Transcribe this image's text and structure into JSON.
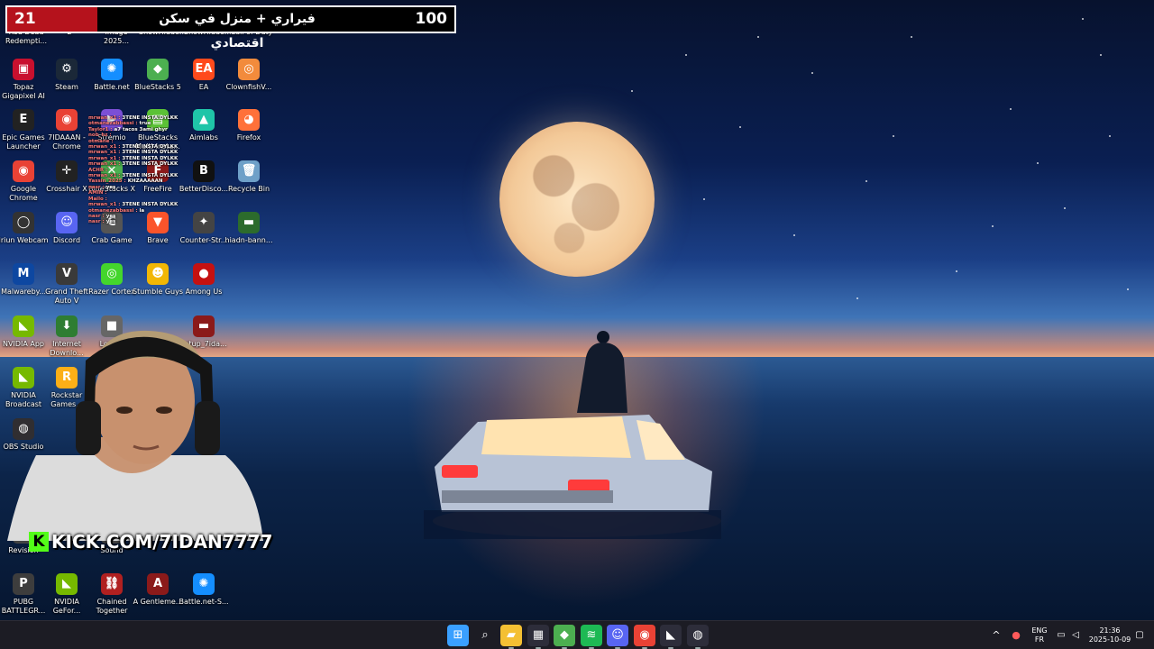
{
  "banner": {
    "left_count": "21",
    "goal_text": "فيراري + منزل في سكن اقتصادي",
    "right_count": "100"
  },
  "partial_top_labels": [
    "Red Dead Redempti...",
    "2",
    "Image 2025...",
    "ShowHidde...",
    "ShowHidde...",
    "Call of Duty"
  ],
  "desktop_icons": [
    {
      "label": "Topaz Gigapixel AI",
      "icon": "topaz-icon",
      "color": "#c8102e",
      "glyph": "▣"
    },
    {
      "label": "Steam",
      "icon": "steam-icon",
      "color": "#1b2838",
      "glyph": "⚙"
    },
    {
      "label": "Battle.net",
      "icon": "battlenet-icon",
      "color": "#148eff",
      "glyph": "✺"
    },
    {
      "label": "BlueStacks 5",
      "icon": "bluestacks-icon",
      "color": "#4caf50",
      "glyph": "◆"
    },
    {
      "label": "EA",
      "icon": "ea-icon",
      "color": "#ff4a1c",
      "glyph": "EA"
    },
    {
      "label": "ClownfishV...",
      "icon": "clownfish-icon",
      "color": "#f28b3c",
      "glyph": "◎"
    },
    {
      "label": "Epic Games Launcher",
      "icon": "epic-games-icon",
      "color": "#222222",
      "glyph": "E"
    },
    {
      "label": "7IDAAAN - Chrome",
      "icon": "chrome-icon",
      "color": "#e94235",
      "glyph": "◉"
    },
    {
      "label": "Stremio",
      "icon": "stremio-icon",
      "color": "#7b4fd6",
      "glyph": "▶"
    },
    {
      "label": "BlueStacks Multi-Insta...",
      "icon": "bluestacks-multi-icon",
      "color": "#5bc236",
      "glyph": "▤"
    },
    {
      "label": "Aimlabs",
      "icon": "aimlabs-icon",
      "color": "#1fc5a8",
      "glyph": "▲"
    },
    {
      "label": "Firefox",
      "icon": "firefox-icon",
      "color": "#ff7139",
      "glyph": "◕"
    },
    {
      "label": "Google Chrome",
      "icon": "chrome-icon",
      "color": "#e94235",
      "glyph": "◉"
    },
    {
      "label": "Crosshair X",
      "icon": "crosshair-icon",
      "color": "#222222",
      "glyph": "✛"
    },
    {
      "label": "BlueStacks X",
      "icon": "bluestacks-x-icon",
      "color": "#4caf50",
      "glyph": "✕"
    },
    {
      "label": "FreeFire",
      "icon": "freefire-icon",
      "color": "#8b1a1a",
      "glyph": "F"
    },
    {
      "label": "BetterDisco...",
      "icon": "betterdiscord-icon",
      "color": "#111111",
      "glyph": "B"
    },
    {
      "label": "Recycle Bin",
      "icon": "recycle-bin-icon",
      "color": "#6ea0c8",
      "glyph": "🗑"
    },
    {
      "label": "Iriun Webcam",
      "icon": "iriun-icon",
      "color": "#333333",
      "glyph": "◯"
    },
    {
      "label": "Discord",
      "icon": "discord-icon",
      "color": "#5865f2",
      "glyph": "☺"
    },
    {
      "label": "Crab Game",
      "icon": "crab-game-icon",
      "color": "#555555",
      "glyph": "C"
    },
    {
      "label": "Brave",
      "icon": "brave-icon",
      "color": "#fb542b",
      "glyph": "▼"
    },
    {
      "label": "Counter-Str...",
      "icon": "counter-strike-icon",
      "color": "#444444",
      "glyph": "✦"
    },
    {
      "label": "hiadn-bann...",
      "icon": "file-icon",
      "color": "#2c6b2c",
      "glyph": "▬"
    },
    {
      "label": "Malwareby...",
      "icon": "malwarebytes-icon",
      "color": "#0d47a1",
      "glyph": "M"
    },
    {
      "label": "Grand Theft Auto V",
      "icon": "gta-icon",
      "color": "#3a3a3a",
      "glyph": "V"
    },
    {
      "label": "Razer Cortex",
      "icon": "razer-icon",
      "color": "#44d62c",
      "glyph": "◎"
    },
    {
      "label": "Stumble Guys",
      "icon": "stumble-guys-icon",
      "color": "#f2b705",
      "glyph": "☻"
    },
    {
      "label": "Among Us",
      "icon": "among-us-icon",
      "color": "#c51111",
      "glyph": "●"
    },
    {
      "label": "NVIDIA App",
      "icon": "nvidia-icon",
      "color": "#76b900",
      "glyph": "◣"
    },
    {
      "label": "Internet Downlo...",
      "icon": "idm-icon",
      "color": "#2e7d32",
      "glyph": "⬇"
    },
    {
      "label": "Lone...",
      "icon": "app-icon",
      "color": "#666666",
      "glyph": "■"
    },
    {
      "label": "setup_7ida...",
      "icon": "setup-icon",
      "color": "#8b1a1a",
      "glyph": "▬"
    },
    {
      "label": "NVIDIA Broadcast",
      "icon": "nvidia-broadcast-icon",
      "color": "#76b900",
      "glyph": "◣"
    },
    {
      "label": "Rockstar Games...",
      "icon": "rockstar-icon",
      "color": "#fcaf17",
      "glyph": "R"
    },
    {
      "label": "OBS Studio",
      "icon": "obs-icon",
      "color": "#302e31",
      "glyph": "◍"
    },
    {
      "label": "Revision",
      "icon": "revision-icon",
      "color": "#444444",
      "glyph": "R"
    },
    {
      "label": "Sound",
      "icon": "sound-icon",
      "color": "#444444",
      "glyph": "♪"
    },
    {
      "label": "PUBG BATTLEGR...",
      "icon": "pubg-icon",
      "color": "#3d3d3d",
      "glyph": "P"
    },
    {
      "label": "NVIDIA GeFor...",
      "icon": "geforce-icon",
      "color": "#76b900",
      "glyph": "◣"
    },
    {
      "label": "Chained Together",
      "icon": "chained-together-icon",
      "color": "#b02020",
      "glyph": "⛓"
    },
    {
      "label": "A Gentleme...",
      "icon": "gentleman-icon",
      "color": "#8b1a1a",
      "glyph": "A"
    },
    {
      "label": "Battle.net-S...",
      "icon": "battlenet-icon",
      "color": "#148eff",
      "glyph": "✺"
    }
  ],
  "chat": [
    {
      "user": "mrwan_x1 :",
      "msg": "3TENE INSTA DYLKK"
    },
    {
      "user": "otmanezabbassi :",
      "msg": "true"
    },
    {
      "user": "Taylor1 :",
      "msg": "a7 tacos 3ami ghyr"
    },
    {
      "user": "nob_hz :",
      "msg": ""
    },
    {
      "user": "otmane :",
      "msg": ""
    },
    {
      "user": "mrwan_x1 :",
      "msg": "3TENE INSTA DYLKK"
    },
    {
      "user": "mrwan_x1 :",
      "msg": "3TENE INSTA DYLKK"
    },
    {
      "user": "mrwan_x1 :",
      "msg": "3TENE INSTA DYLKK"
    },
    {
      "user": "mrwan_x1 :",
      "msg": "3TENE INSTA DYLKK"
    },
    {
      "user": "ACHR :",
      "msg": ""
    },
    {
      "user": "mrwan_x1 :",
      "msg": "3TENE INSTA DYLKK"
    },
    {
      "user": "Yassin_2025 :",
      "msg": "KHZAAAAAN"
    },
    {
      "user": "nasr :",
      "msg": "yes"
    },
    {
      "user": "AMIN :",
      "msg": ""
    },
    {
      "user": "Mailo :",
      "msg": ""
    },
    {
      "user": "mrwan_x1 :",
      "msg": "3TENE INSTA DYLKK"
    },
    {
      "user": "otmanezabbassi :",
      "msg": "la"
    },
    {
      "user": "nasr :",
      "msg": "yes"
    },
    {
      "user": "nasr :",
      "msg": "yes"
    }
  ],
  "stream": {
    "kick_url": "KICK.COM/7IDAN7777",
    "kick_logo": "K"
  },
  "taskbar": {
    "apps": [
      {
        "name": "start-button",
        "glyph": "⊞",
        "color": "#3aa0ff"
      },
      {
        "name": "search-icon",
        "glyph": "⌕",
        "color": "transparent"
      },
      {
        "name": "file-explorer-icon",
        "glyph": "▰",
        "color": "#f4c033"
      },
      {
        "name": "store-icon",
        "glyph": "▦",
        "color": "#2d2d3a"
      },
      {
        "name": "bluestacks-icon",
        "glyph": "◆",
        "color": "#4caf50"
      },
      {
        "name": "spotify-icon",
        "glyph": "≋",
        "color": "#1db954"
      },
      {
        "name": "discord-icon",
        "glyph": "☺",
        "color": "#5865f2"
      },
      {
        "name": "chrome-icon",
        "glyph": "◉",
        "color": "#e94235"
      },
      {
        "name": "nvidia-icon",
        "glyph": "◣",
        "color": "#2d2d3a"
      },
      {
        "name": "obs-icon",
        "glyph": "◍",
        "color": "#2d2d3a"
      }
    ],
    "tray": {
      "chevron": "^",
      "lang_top": "ENG",
      "lang_bottom": "FR",
      "time": "21:36",
      "date": "2025-10-09"
    }
  }
}
